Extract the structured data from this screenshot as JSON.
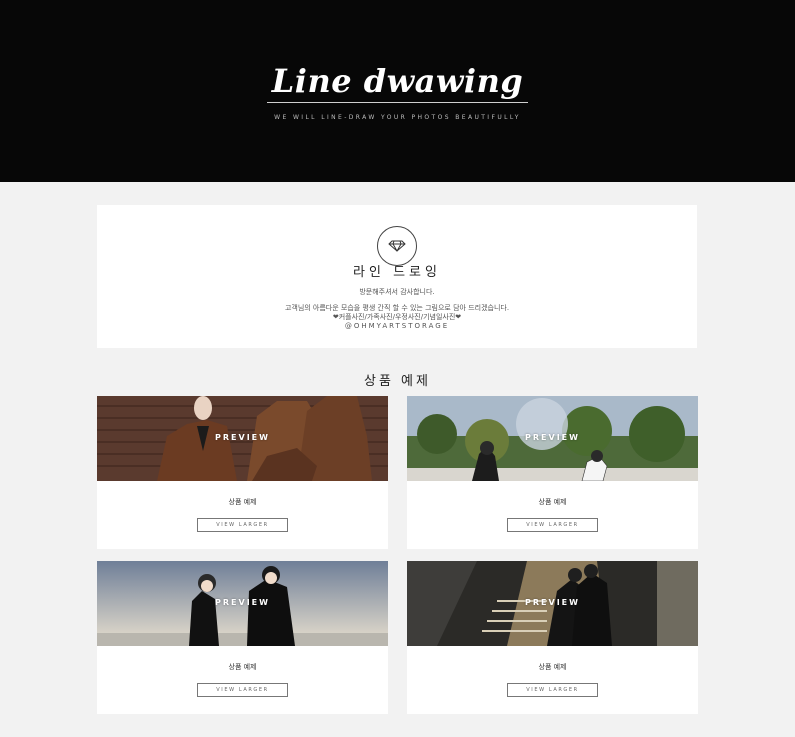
{
  "hero": {
    "title": "Line dwawing",
    "subtitle": "WE WILL LINE-DRAW YOUR PHOTOS BEAUTIFULLY"
  },
  "intro": {
    "icon": "diamond-icon",
    "title": "라인 드로잉",
    "thanks": "방문해주셔서 감사합니다.",
    "lines": [
      "고객님의 아름다운 모습을 평생 간직 할 수 있는 그림으로 담아 드리겠습니다.",
      "❤커플사진/가족사진/우정사진/기념일사진❤",
      "@OHMYARTSTORAGE"
    ]
  },
  "section_title": "상품 예제",
  "products": [
    {
      "preview": "PREVIEW",
      "name": "상품 예제",
      "button": "VIEW LARGER"
    },
    {
      "preview": "PREVIEW",
      "name": "상품 예제",
      "button": "VIEW LARGER"
    },
    {
      "preview": "PREVIEW",
      "name": "상품 예제",
      "button": "VIEW LARGER"
    },
    {
      "preview": "PREVIEW",
      "name": "상품 예제",
      "button": "VIEW LARGER"
    }
  ]
}
